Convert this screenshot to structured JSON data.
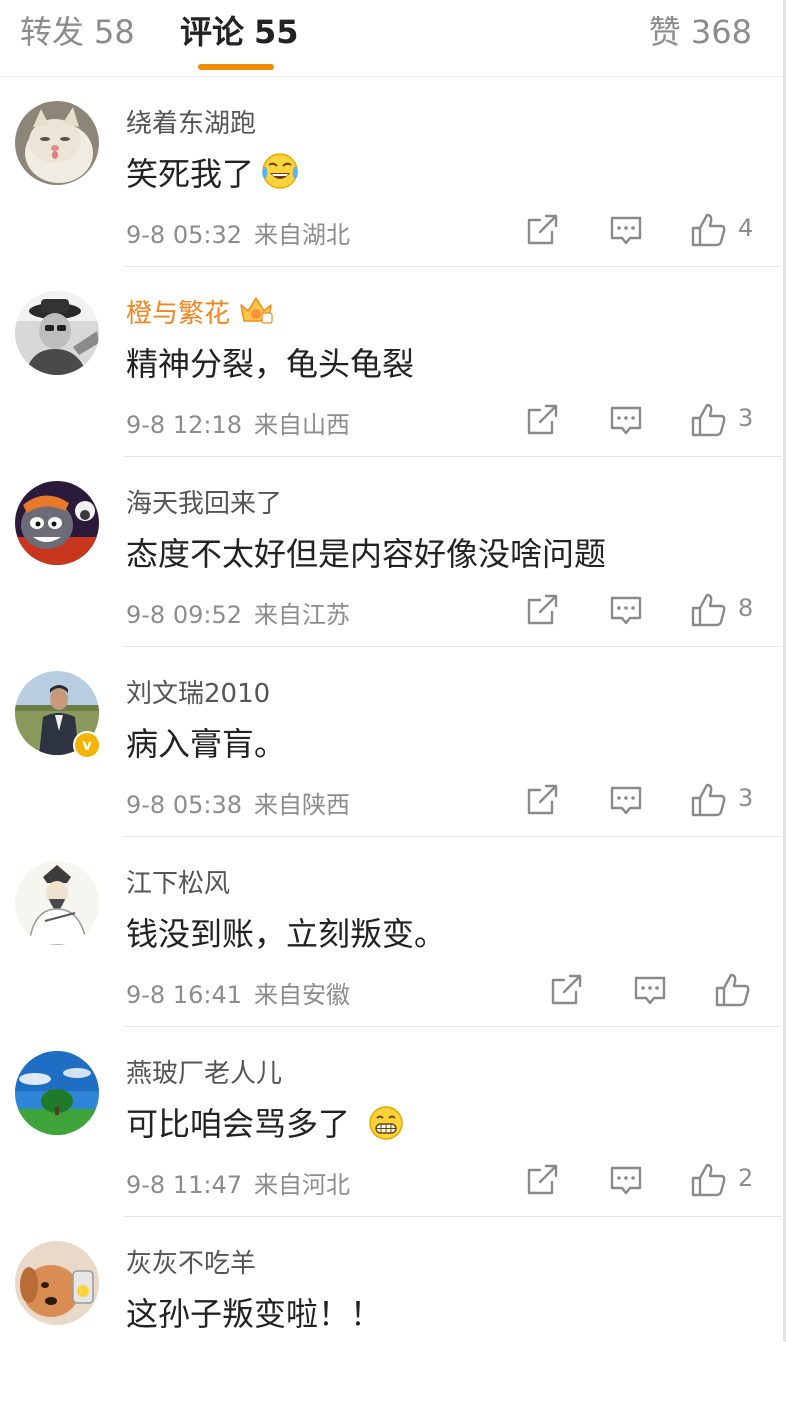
{
  "tabs": {
    "repost": {
      "label": "转发",
      "count": "58"
    },
    "comments": {
      "label": "评论",
      "count": "55"
    },
    "likes": {
      "label": "赞",
      "count": "368"
    },
    "active": "comments",
    "accent_color": "#f08c00"
  },
  "comments": [
    {
      "name": "绕着东湖跑",
      "text": "笑死我了",
      "emoji": "tears-of-joy-emoji",
      "date": "9-8 05:32",
      "location": "来自湖北",
      "likes": "4",
      "avatar": "cat-avatar"
    },
    {
      "name": "橙与繁花",
      "text": "精神分裂，龟头龟裂",
      "vip": true,
      "badge": "crown-vip-badge",
      "date": "9-8 12:18",
      "location": "来自山西",
      "likes": "3",
      "avatar": "old-man-avatar"
    },
    {
      "name": "海天我回来了",
      "text": "态度不太好但是内容好像没啥问题",
      "date": "9-8 09:52",
      "location": "来自江苏",
      "likes": "8",
      "avatar": "cartoon-wolf-avatar"
    },
    {
      "name": "刘文瑞2010",
      "text": "病入膏肓。",
      "verified": true,
      "date": "9-8 05:38",
      "location": "来自陕西",
      "likes": "3",
      "avatar": "man-outdoors-avatar"
    },
    {
      "name": "江下松风",
      "text": "钱没到账，立刻叛变。",
      "date": "9-8 16:41",
      "location": "来自安徽",
      "likes": "",
      "avatar": "scholar-drawing-avatar"
    },
    {
      "name": "燕玻厂老人儿",
      "text": "可比咱会骂多了",
      "emoji": "grinning-emoji",
      "date": "9-8 11:47",
      "location": "来自河北",
      "likes": "2",
      "avatar": "landscape-avatar"
    },
    {
      "name": "灰灰不吃羊",
      "text": "这孙子叛变啦！！",
      "avatar": "dog-avatar"
    }
  ]
}
